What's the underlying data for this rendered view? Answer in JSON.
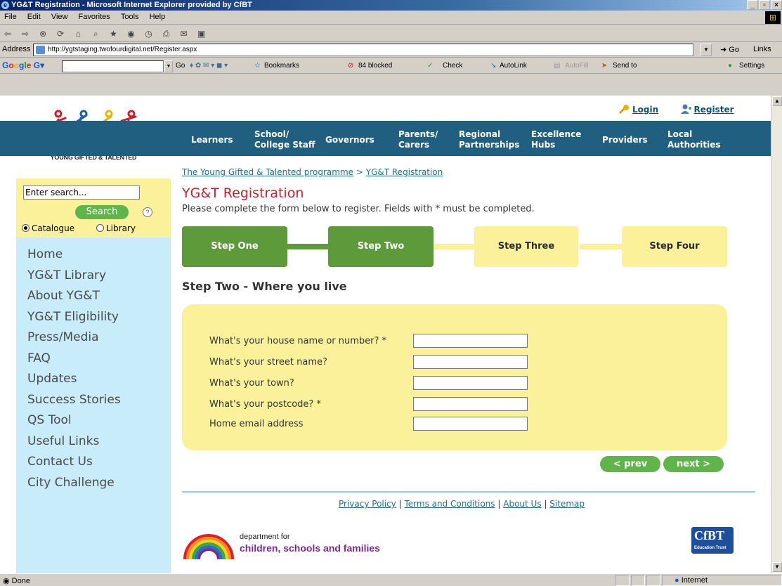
{
  "window": {
    "title": "YG&T Registration - Microsoft Internet Explorer provided by CfBT",
    "controls": [
      "_",
      "▫",
      "×"
    ]
  },
  "menubar": [
    "File",
    "Edit",
    "View",
    "Favorites",
    "Tools",
    "Help"
  ],
  "address": {
    "label": "Address",
    "url": "http://ygtstaging.twofourdigital.net/Register.aspx",
    "go_label": "Go",
    "links_label": "Links"
  },
  "googlebar": {
    "logo": "Google",
    "go_label": "Go",
    "items": {
      "bookmarks": "Bookmarks",
      "blocked": "84 blocked",
      "check": "Check",
      "autolink": "AutoLink",
      "autofill": "AutoFill",
      "sendto": "Send to",
      "settings": "Settings"
    }
  },
  "site": {
    "logo_text": "YOUNG GIFTED & TALENTED",
    "search": {
      "placeholder": "Enter search...",
      "button": "Search",
      "help": "?",
      "radio_catalogue": "Catalogue",
      "radio_library": "Library",
      "selected": "Catalogue"
    },
    "leftnav": [
      "Home",
      "YG&T Library",
      "About YG&T",
      "YG&T Eligibility",
      "Press/Media",
      "FAQ",
      "Updates",
      "Success Stories",
      "QS Tool",
      "Useful Links",
      "Contact Us",
      "City Challenge"
    ],
    "toplinks": {
      "login": "Login",
      "register": "Register"
    },
    "topnav": {
      "learners": "Learners",
      "school_1": "School/",
      "school_2": "College Staff",
      "governors": "Governors",
      "parents_1": "Parents/",
      "parents_2": "Carers",
      "regional_1": "Regional",
      "regional_2": "Partnerships",
      "excellence_1": "Excellence",
      "excellence_2": "Hubs",
      "providers": "Providers",
      "local_1": "Local",
      "local_2": "Authorities"
    },
    "breadcrumb": {
      "home": "The Young Gifted & Talented programme",
      "sep": ">",
      "current": "YG&T Registration"
    },
    "title": "YG&T Registration",
    "intro": "Please complete the form below to register. Fields with * must be completed.",
    "steps": [
      {
        "label": "Step One",
        "state": "done"
      },
      {
        "label": "Step Two",
        "state": "done"
      },
      {
        "label": "Step Three",
        "state": "todo"
      },
      {
        "label": "Step Four",
        "state": "todo"
      }
    ],
    "step_heading": "Step Two - Where you live",
    "form": [
      {
        "label": "What's your house name or number? *",
        "value": ""
      },
      {
        "label": "What's your street name?",
        "value": ""
      },
      {
        "label": "What's your town?",
        "value": ""
      },
      {
        "label": "What's your postcode? *",
        "value": ""
      },
      {
        "label": "Home email address",
        "value": ""
      }
    ],
    "buttons": {
      "prev": "< prev",
      "next": "next >"
    },
    "footer": {
      "privacy": "Privacy Policy",
      "terms": "Terms and Conditions",
      "about": "About Us",
      "sitemap": "Sitemap",
      "sep": "|"
    },
    "dcsf": {
      "line1": "department for",
      "line2": "children, schools and families"
    },
    "cfbt": {
      "name": "CfBT",
      "sub": "Education Trust"
    }
  },
  "statusbar": {
    "text": "Done",
    "zone": "Internet"
  },
  "colors": {
    "nav_blue": "#205f80",
    "step_green": "#5c9a3a",
    "panel_yellow": "#fbf19a",
    "title_red": "#c81e28",
    "leftnav_blue": "#c8ecfa"
  }
}
